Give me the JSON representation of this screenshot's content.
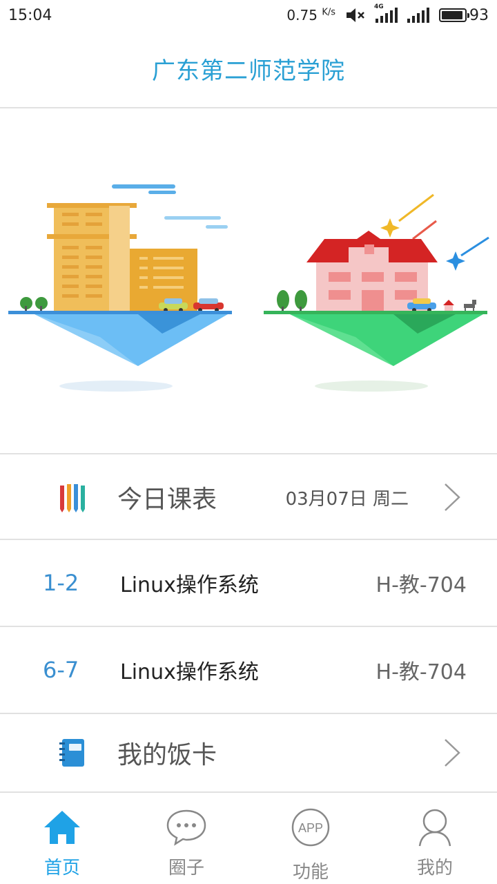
{
  "status_bar": {
    "time": "15:04",
    "net_speed": "0.75",
    "net_unit": "K/s",
    "network_tag": "4G",
    "battery_level": "93",
    "battery_fraction": 0.93
  },
  "header": {
    "title": "广东第二师范学院"
  },
  "schedule": {
    "label": "今日课表",
    "date": "03月07日 周二"
  },
  "courses": [
    {
      "period": "1-2",
      "name": "Linux操作系统",
      "room": "H-教-704"
    },
    {
      "period": "6-7",
      "name": "Linux操作系统",
      "room": "H-教-704"
    }
  ],
  "meal_card": {
    "label": "我的饭卡"
  },
  "tabs": [
    {
      "label": "首页",
      "icon": "home-icon",
      "active": true
    },
    {
      "label": "圈子",
      "icon": "chat-bubble-icon",
      "active": false
    },
    {
      "label": "功能",
      "icon": "app-icon",
      "active": false,
      "icon_text": "APP"
    },
    {
      "label": "我的",
      "icon": "user-icon",
      "active": false
    }
  ],
  "colors": {
    "accent": "#1fa2e6",
    "title": "#2aa0d4",
    "period": "#3a8fd0"
  }
}
